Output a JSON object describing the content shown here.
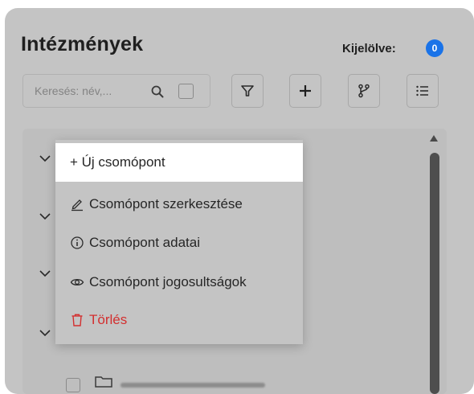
{
  "header": {
    "title": "Intézmények",
    "selected_label": "Kijelölve:",
    "selected_count": "0"
  },
  "toolbar": {
    "search_placeholder": "Keresés: név,...",
    "search_icon": "search-icon",
    "buttons": [
      {
        "name": "filter-button",
        "icon": "filter-icon"
      },
      {
        "name": "add-button",
        "icon": "plus-icon"
      },
      {
        "name": "branch-button",
        "icon": "branch-icon"
      },
      {
        "name": "list-button",
        "icon": "list-icon"
      }
    ]
  },
  "context_menu": {
    "items": [
      {
        "label": "+ Új csomópont",
        "icon": "plus-icon",
        "highlighted": true
      },
      {
        "label": "Csomópont szerkesztése",
        "icon": "pencil-icon"
      },
      {
        "label": "Csomópont adatai",
        "icon": "info-icon"
      },
      {
        "label": "Csomópont jogosultságok",
        "icon": "eye-icon"
      },
      {
        "label": "Törlés",
        "icon": "trash-icon",
        "danger": true
      }
    ]
  },
  "colors": {
    "panel_background": "#c4c4c4",
    "badge": "#1a73e8",
    "danger": "#d32f2f",
    "menu_highlight": "#ffffff"
  }
}
